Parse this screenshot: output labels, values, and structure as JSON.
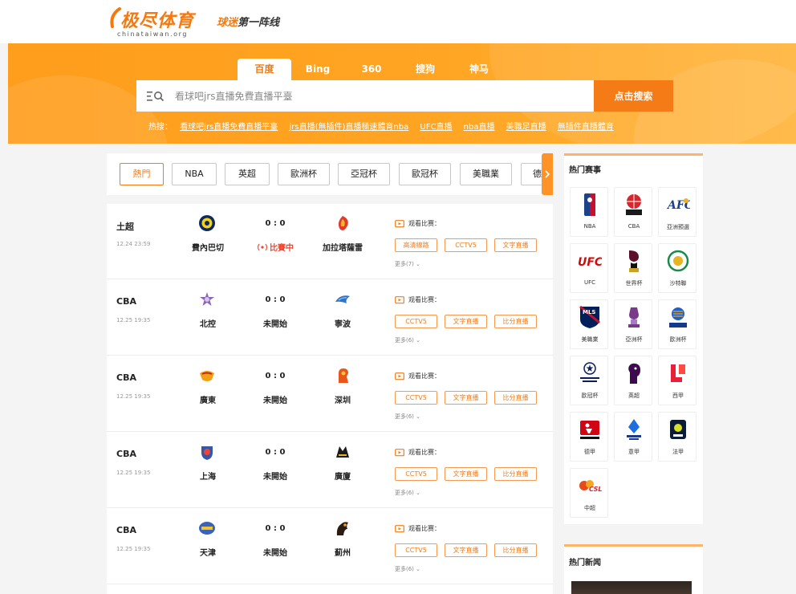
{
  "header": {
    "logo_text": "极尽体育",
    "logo_domain": "chinataiwan.org",
    "slogan_highlight": "球迷",
    "slogan_rest": "第一阵线"
  },
  "search": {
    "engines": [
      "百度",
      "Bing",
      "360",
      "搜狗",
      "神马"
    ],
    "active_engine": "百度",
    "placeholder": "看球吧jrs直播免費直播平臺",
    "button_label": "点击搜索",
    "hot_label": "热搜：",
    "hot_links": [
      "看球吧jrs直播免費直播平臺",
      "jrs直播(無插件)直播極速體育nba",
      "UFC直播",
      "nba直播",
      "美職足直播",
      "無插件直播體育"
    ]
  },
  "categories": {
    "items": [
      "熱門",
      "NBA",
      "英超",
      "歐洲杯",
      "亞冠杯",
      "歐冠杯",
      "美職業",
      "德甲"
    ],
    "active": "熱門"
  },
  "matches": [
    {
      "league": "土超",
      "time": "12.24 23:59",
      "home": "費內巴切",
      "away": "加拉塔薩雷",
      "score": "0 : 0",
      "status": "比賽中",
      "live": true,
      "watch_label": "观看比赛：",
      "links": [
        "高清線路",
        "CCTV5",
        "文字直播"
      ],
      "more": "更多(7)"
    },
    {
      "league": "CBA",
      "time": "12.25 19:35",
      "home": "北控",
      "away": "寧波",
      "score": "0 : 0",
      "status": "未開始",
      "live": false,
      "watch_label": "观看比赛：",
      "links": [
        "CCTV5",
        "文字直播",
        "比分直播"
      ],
      "more": "更多(6)"
    },
    {
      "league": "CBA",
      "time": "12.25 19:35",
      "home": "廣東",
      "away": "深圳",
      "score": "0 : 0",
      "status": "未開始",
      "live": false,
      "watch_label": "观看比赛：",
      "links": [
        "CCTV5",
        "文字直播",
        "比分直播"
      ],
      "more": "更多(6)"
    },
    {
      "league": "CBA",
      "time": "12.25 19:35",
      "home": "上海",
      "away": "廣廈",
      "score": "0 : 0",
      "status": "未開始",
      "live": false,
      "watch_label": "观看比赛：",
      "links": [
        "CCTV5",
        "文字直播",
        "比分直播"
      ],
      "more": "更多(6)"
    },
    {
      "league": "CBA",
      "time": "12.25 19:35",
      "home": "天津",
      "away": "薊州",
      "score": "0 : 0",
      "status": "未開始",
      "live": false,
      "watch_label": "观看比赛：",
      "links": [
        "CCTV5",
        "文字直播",
        "比分直播"
      ],
      "more": "更多(6)"
    }
  ],
  "hot_events": {
    "title": "热门赛事",
    "items": [
      {
        "name": "NBA",
        "icon": "nba-logo"
      },
      {
        "name": "CBA",
        "icon": "cba-logo"
      },
      {
        "name": "亞洲預選",
        "icon": "afc-logo"
      },
      {
        "name": "UFC",
        "icon": "ufc-logo"
      },
      {
        "name": "世界杯",
        "icon": "world-cup-logo"
      },
      {
        "name": "沙特聯",
        "icon": "saudi-league-logo"
      },
      {
        "name": "美職業",
        "icon": "mls-logo"
      },
      {
        "name": "亞洲杯",
        "icon": "asian-cup-logo"
      },
      {
        "name": "歐洲杯",
        "icon": "euro-logo"
      },
      {
        "name": "歐冠杯",
        "icon": "champions-league-logo"
      },
      {
        "name": "英超",
        "icon": "premier-league-logo"
      },
      {
        "name": "西甲",
        "icon": "laliga-logo"
      },
      {
        "name": "德甲",
        "icon": "bundesliga-logo"
      },
      {
        "name": "意甲",
        "icon": "serie-a-logo"
      },
      {
        "name": "法甲",
        "icon": "ligue1-logo"
      },
      {
        "name": "中超",
        "icon": "csl-logo"
      }
    ]
  },
  "hot_news": {
    "title": "热门新闻"
  },
  "colors": {
    "accent": "#f47b15",
    "banner": "#ffa523",
    "live": "#f4432c"
  }
}
